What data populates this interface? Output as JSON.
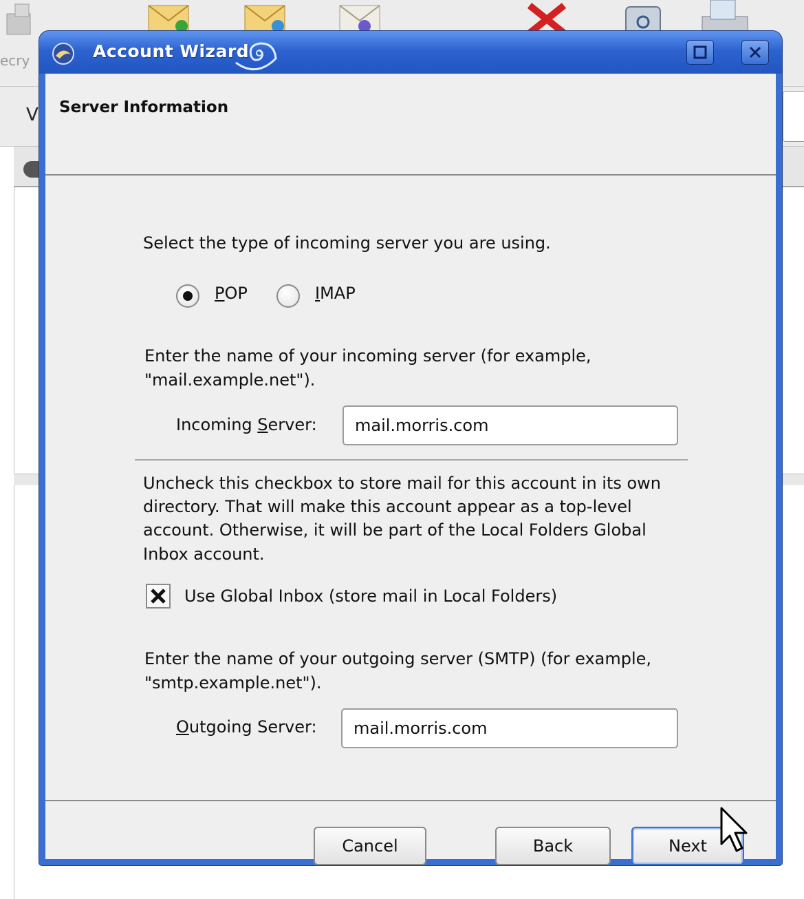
{
  "background_app": {
    "toolbar_label_partial": "ecry",
    "search_label_partial": "V"
  },
  "dialog": {
    "title": "Account Wizard",
    "page_title": "Server Information",
    "server_type_prompt": "Select the type of incoming server you are using.",
    "server_type_options": [
      {
        "accesskey": "P",
        "rest": "OP",
        "selected": true
      },
      {
        "accesskey": "I",
        "rest": "MAP",
        "selected": false
      }
    ],
    "incoming_prompt_line1": "Enter the name of your incoming server (for example,",
    "incoming_prompt_line2": "\"mail.example.net\").",
    "incoming_label": {
      "before": "Incoming ",
      "accesskey": "S",
      "after": "erver:"
    },
    "incoming_value": "mail.morris.com",
    "global_inbox_desc": [
      "Uncheck this checkbox to store mail for this account in its own",
      "directory. That will make this account appear as a top-level",
      "account. Otherwise, it will be part of the Local Folders Global",
      "Inbox account."
    ],
    "global_inbox_label": "Use Global Inbox (store mail in Local Folders)",
    "global_inbox_checked": true,
    "outgoing_prompt_line1": "Enter the name of your outgoing server (SMTP) (for example,",
    "outgoing_prompt_line2": "\"smtp.example.net\").",
    "outgoing_label": {
      "accesskey": "O",
      "after": "utgoing Server:"
    },
    "outgoing_value": "mail.morris.com",
    "buttons": {
      "cancel": "Cancel",
      "back": "Back",
      "next": "Next"
    }
  },
  "colors": {
    "titlebar_blue": "#2d63cf",
    "dialog_bg": "#efefef"
  },
  "icons": [
    "mail-get-icon",
    "mail-compose-icon",
    "mail-reply-icon",
    "delete-icon",
    "trash-icon",
    "print-icon",
    "thunderbird-icon",
    "maximize-icon",
    "close-icon",
    "mouse-pointer-icon"
  ]
}
